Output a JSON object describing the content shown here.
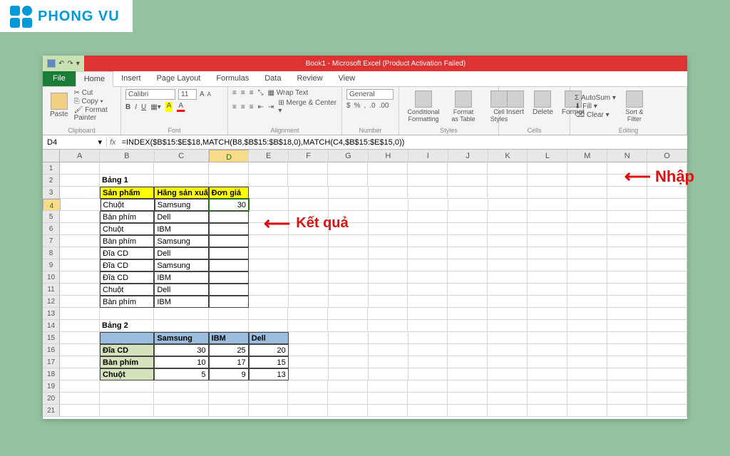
{
  "brand": "PHONG VU",
  "window": {
    "title": "Book1 - Microsoft Excel (Product Activation Failed)"
  },
  "tabs": {
    "file": "File",
    "home": "Home",
    "insert": "Insert",
    "page": "Page Layout",
    "formulas": "Formulas",
    "data": "Data",
    "review": "Review",
    "view": "View"
  },
  "ribbon": {
    "clipboard": {
      "paste": "Paste",
      "cut": "Cut",
      "copy": "Copy",
      "painter": "Format Painter",
      "label": "Clipboard"
    },
    "font": {
      "name": "Calibri",
      "size": "11",
      "label": "Font"
    },
    "align": {
      "wrap": "Wrap Text",
      "merge": "Merge & Center",
      "label": "Alignment"
    },
    "number": {
      "fmt": "General",
      "label": "Number"
    },
    "styles": {
      "cond": "Conditional Formatting",
      "fmt": "Format as Table",
      "cell": "Cell Styles",
      "label": "Styles"
    },
    "cells": {
      "ins": "Insert",
      "del": "Delete",
      "fmt": "Format",
      "label": "Cells"
    },
    "editing": {
      "sum": "AutoSum",
      "fill": "Fill",
      "clear": "Clear",
      "sort": "Sort & Filter",
      "label": "Editing"
    }
  },
  "namebox": "D4",
  "formula": "=INDEX($B$15:$E$18,MATCH(B8,$B$15:$B$18,0),MATCH(C4,$B$15:$E$15,0))",
  "cols": [
    "",
    "A",
    "B",
    "C",
    "D",
    "E",
    "F",
    "G",
    "H",
    "I",
    "J",
    "K",
    "L",
    "M",
    "N",
    "O"
  ],
  "t1": {
    "title": "Bảng 1",
    "h": [
      "Sản phẩm",
      "Hãng sản xuất",
      "Đơn giá"
    ],
    "rows": [
      [
        "Chuột",
        "Samsung",
        "30"
      ],
      [
        "Bàn phím",
        "Dell",
        ""
      ],
      [
        "Chuột",
        "IBM",
        ""
      ],
      [
        "Bàn phím",
        "Samsung",
        ""
      ],
      [
        "Đĩa CD",
        "Dell",
        ""
      ],
      [
        "Đĩa CD",
        "Samsung",
        ""
      ],
      [
        "Đĩa CD",
        "IBM",
        ""
      ],
      [
        "Chuột",
        "Dell",
        ""
      ],
      [
        "Bàn phím",
        "IBM",
        ""
      ]
    ]
  },
  "t2": {
    "title": "Bảng 2",
    "h": [
      "",
      "Samsung",
      "IBM",
      "Dell"
    ],
    "rows": [
      [
        "Đĩa CD",
        "30",
        "25",
        "20"
      ],
      [
        "Bàn phím",
        "10",
        "17",
        "15"
      ],
      [
        "Chuột",
        "5",
        "9",
        "13"
      ]
    ]
  },
  "anno": {
    "result": "Kết quả",
    "input": "Nhập"
  }
}
